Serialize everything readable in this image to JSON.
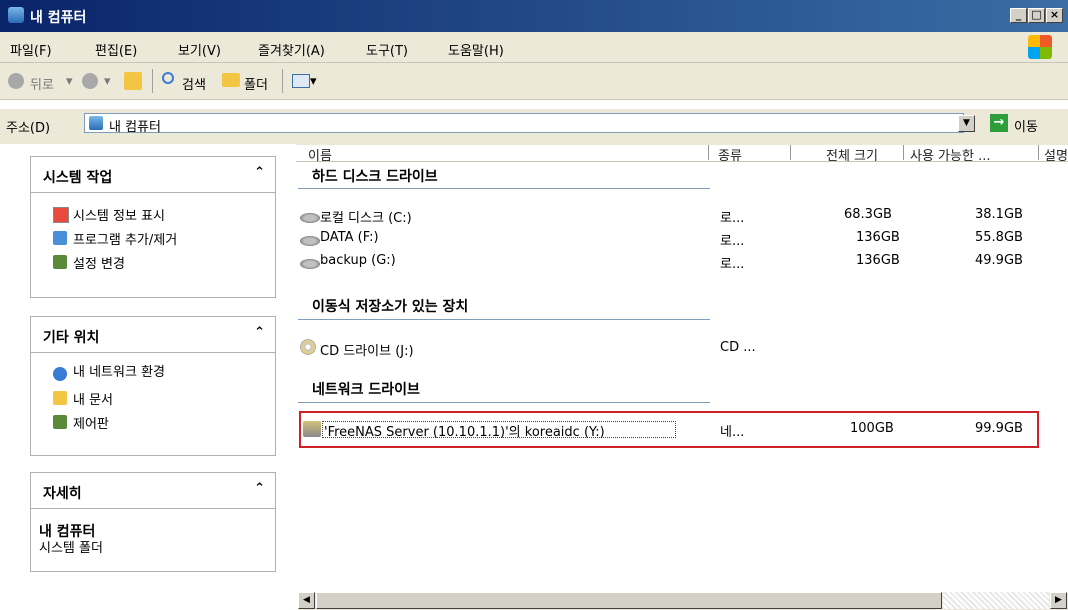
{
  "window": {
    "title": "내 컴퓨터"
  },
  "menu": [
    "파일(F)",
    "편집(E)",
    "보기(V)",
    "즐겨찾기(A)",
    "도구(T)",
    "도움말(H)"
  ],
  "toolbar": {
    "back": "뒤로",
    "search": "검색",
    "folders": "폴더"
  },
  "address": {
    "label": "주소(D)",
    "value": "내 컴퓨터",
    "go": "이동"
  },
  "left_panels": {
    "system_tasks": {
      "title": "시스템 작업",
      "items": [
        "시스템 정보 표시",
        "프로그램 추가/제거",
        "설정 변경"
      ]
    },
    "other_places": {
      "title": "기타 위치",
      "items": [
        "내 네트워크 환경",
        "내 문서",
        "제어판"
      ]
    },
    "details": {
      "title": "자세히",
      "name": "내 컴퓨터",
      "desc": "시스템 폴더"
    }
  },
  "columns": {
    "name": "이름",
    "type": "종류",
    "total": "전체 크기",
    "free": "사용 가능한 ...",
    "desc": "설명"
  },
  "groups": {
    "hard_disks": {
      "title": "하드 디스크 드라이브",
      "rows": [
        {
          "name": "로컬 디스크 (C:)",
          "type": "로...",
          "total": "68.3GB",
          "free": "38.1GB"
        },
        {
          "name": "DATA (F:)",
          "type": "로...",
          "total": "136GB",
          "free": "55.8GB"
        },
        {
          "name": "backup (G:)",
          "type": "로...",
          "total": "136GB",
          "free": "49.9GB"
        }
      ]
    },
    "removable": {
      "title": "이동식 저장소가 있는 장치",
      "rows": [
        {
          "name": "CD 드라이브 (J:)",
          "type": "CD ..."
        }
      ]
    },
    "network": {
      "title": "네트워크 드라이브",
      "rows": [
        {
          "name": "'FreeNAS Server (10.10.1.1)'의 koreaidc (Y:)",
          "type": "네...",
          "total": "100GB",
          "free": "99.9GB"
        }
      ]
    }
  }
}
